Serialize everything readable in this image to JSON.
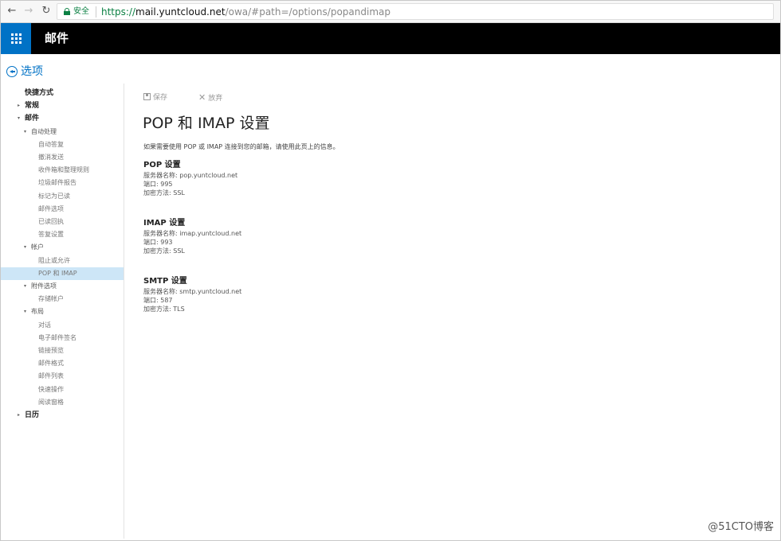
{
  "browser": {
    "secure_label": "安全",
    "url_scheme": "https://",
    "url_host": "mail.yuntcloud.net",
    "url_path": "/owa/#path=/options/popandimap"
  },
  "header": {
    "app_title": "邮件"
  },
  "options": {
    "title": "选项"
  },
  "sidebar": {
    "items": [
      {
        "label": "快捷方式",
        "level": 1
      },
      {
        "label": "常规",
        "level": 1,
        "caret": "▸"
      },
      {
        "label": "邮件",
        "level": 1,
        "caret": "▾"
      },
      {
        "label": "自动处理",
        "level": 2,
        "caret": "▾"
      },
      {
        "label": "自动答复",
        "level": 3
      },
      {
        "label": "撤消发送",
        "level": 3
      },
      {
        "label": "收件箱和整理规则",
        "level": 3
      },
      {
        "label": "垃圾邮件报告",
        "level": 3
      },
      {
        "label": "标记为已读",
        "level": 3
      },
      {
        "label": "邮件选项",
        "level": 3
      },
      {
        "label": "已读回执",
        "level": 3
      },
      {
        "label": "答复设置",
        "level": 3
      },
      {
        "label": "帐户",
        "level": 2,
        "caret": "▾"
      },
      {
        "label": "阻止或允许",
        "level": 3
      },
      {
        "label": "POP 和 IMAP",
        "level": 3,
        "selected": true
      },
      {
        "label": "附件选项",
        "level": 2,
        "caret": "▾"
      },
      {
        "label": "存储帐户",
        "level": 3
      },
      {
        "label": "布局",
        "level": 2,
        "caret": "▾"
      },
      {
        "label": "对话",
        "level": 3
      },
      {
        "label": "电子邮件签名",
        "level": 3
      },
      {
        "label": "链接预览",
        "level": 3
      },
      {
        "label": "邮件格式",
        "level": 3
      },
      {
        "label": "邮件列表",
        "level": 3
      },
      {
        "label": "快速操作",
        "level": 3
      },
      {
        "label": "阅读窗格",
        "level": 3
      },
      {
        "label": "日历",
        "level": 1,
        "caret": "▸"
      }
    ]
  },
  "toolbar": {
    "save_label": "保存",
    "discard_label": "放弃"
  },
  "main": {
    "title": "POP 和 IMAP 设置",
    "intro": "如果需要使用 POP 或 IMAP 连接到您的邮箱，请使用此页上的信息。",
    "pop": {
      "title": "POP 设置",
      "server": "服务器名称: pop.yuntcloud.net",
      "port": "端口: 995",
      "encryption": "加密方法: SSL"
    },
    "imap": {
      "title": "IMAP 设置",
      "server": "服务器名称: imap.yuntcloud.net",
      "port": "端口: 993",
      "encryption": "加密方法: SSL"
    },
    "smtp": {
      "title": "SMTP 设置",
      "server": "服务器名称: smtp.yuntcloud.net",
      "port": "端口: 587",
      "encryption": "加密方法: TLS"
    }
  },
  "watermark": "@51CTO博客"
}
